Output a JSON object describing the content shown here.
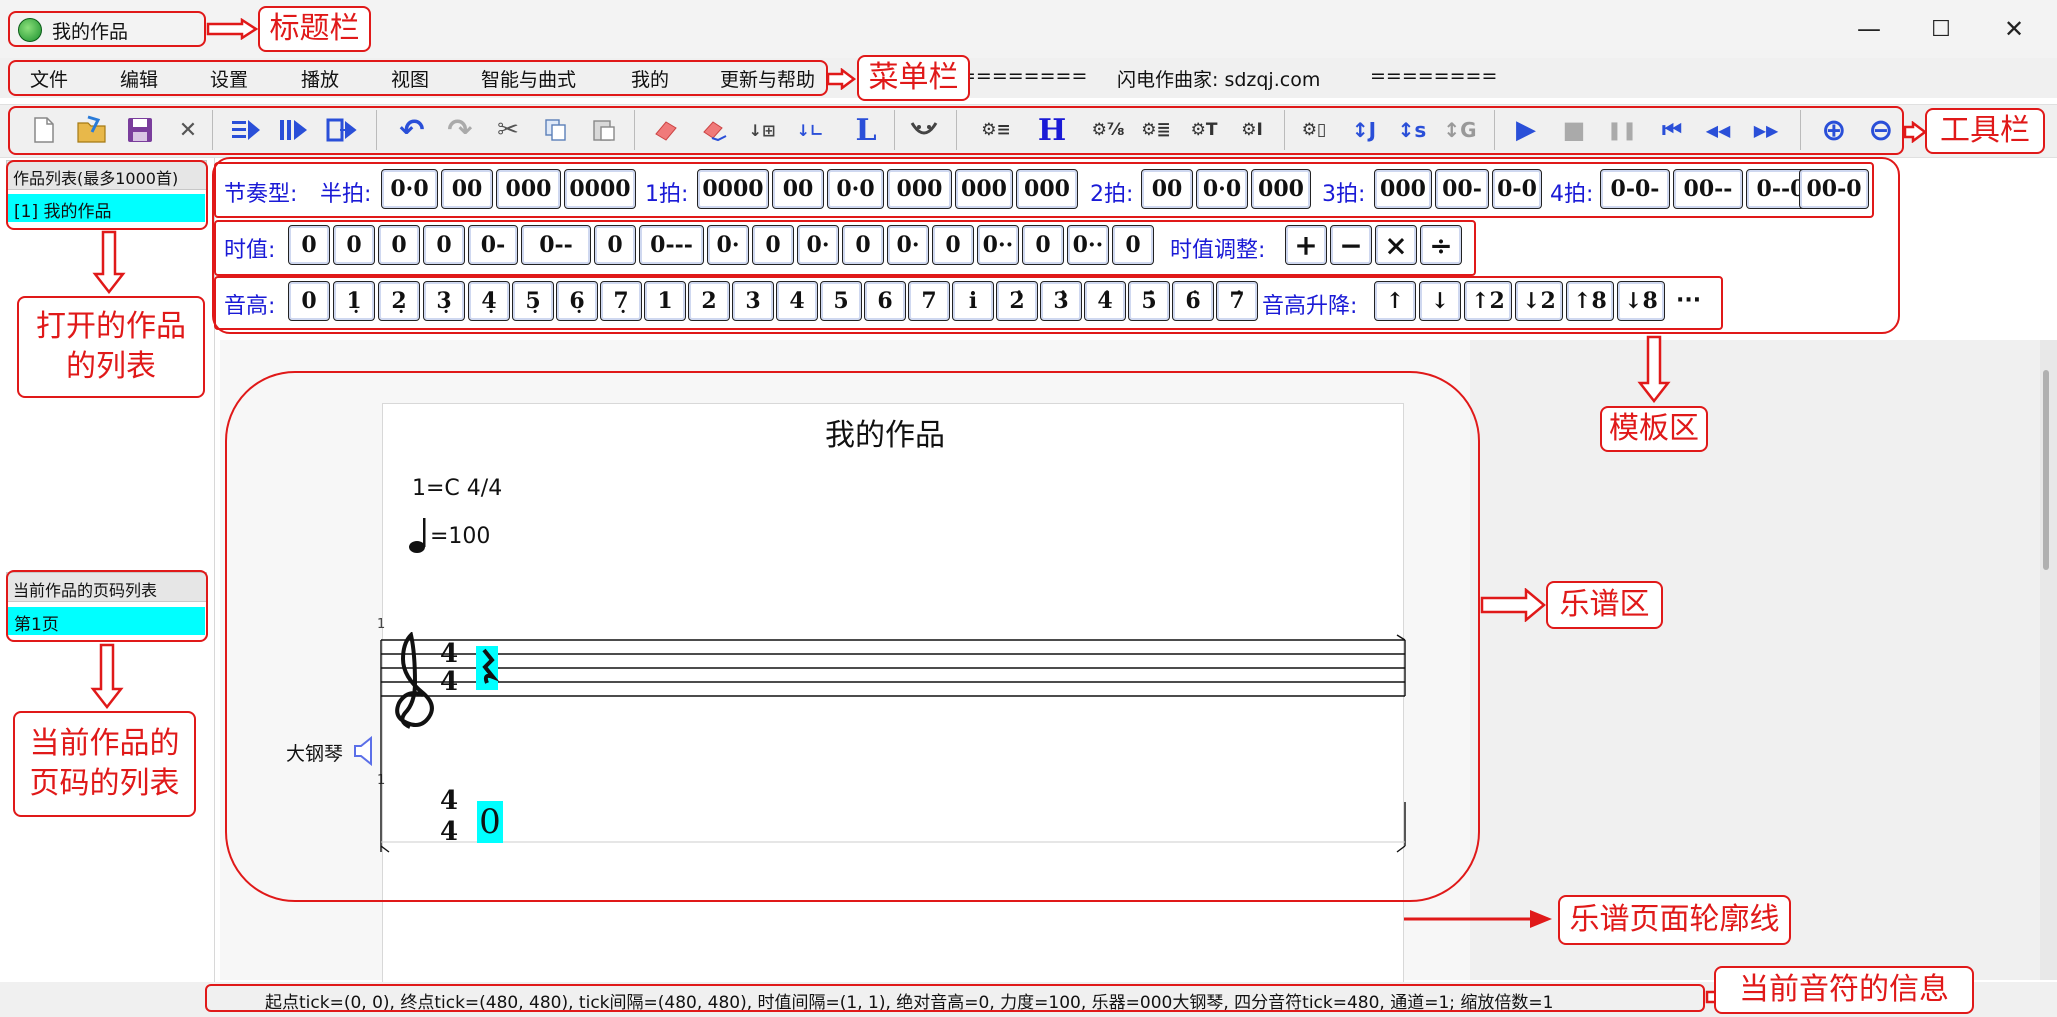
{
  "window": {
    "title": "我的作品",
    "minimize": "—",
    "maximize": "☐",
    "close": "✕"
  },
  "menu": {
    "items": [
      "文件",
      "编辑",
      "设置",
      "播放",
      "视图",
      "智能与曲式",
      "我的",
      "更新与帮助"
    ],
    "extra_left": "========",
    "site": "闪电作曲家: sdzqj.com",
    "extra_right": "========"
  },
  "toolbar": {
    "icons": [
      "new-file-icon",
      "open-folder-icon",
      "save-icon",
      "close-icon",
      "play-from-icon",
      "play-selection-icon",
      "export-icon",
      "undo-icon",
      "redo-icon",
      "cut-icon",
      "copy-icon",
      "paste-icon",
      "eraser-icon",
      "clear-icon",
      "insert-note-icon",
      "insert-rest-icon",
      "lyrics-L-icon",
      "tie-icon",
      "settings-list-icon",
      "heading-H-icon",
      "settings-fraction-icon",
      "settings-lines-icon",
      "settings-T-icon",
      "settings-I-icon",
      "settings-box-icon",
      "transpose-J-icon",
      "transpose-S-icon",
      "transpose-G-icon",
      "play-icon",
      "stop-icon",
      "pause-icon",
      "skip-start-icon",
      "rewind-icon",
      "fast-forward-icon",
      "zoom-in-icon",
      "zoom-out-icon"
    ],
    "glyphs": {
      "close": "✕",
      "undo": "↶",
      "redo": "↷",
      "cut": "✂",
      "L": "L",
      "H": "H",
      "settings_list": "⚙≡",
      "settings_frac": "⚙⅞",
      "settings_lines": "⚙≣",
      "settings_T": "⚙T",
      "settings_I": "⚙I",
      "settings_box": "⚙▯",
      "tJ": "↕J",
      "tS": "↕s",
      "tG": "↕G",
      "play": "▶",
      "stop": "■",
      "pause": "❚❚",
      "skip_start": "⏮",
      "rewind": "◀◀",
      "ff": "▶▶",
      "zoom_in": "⊕",
      "zoom_out": "⊖"
    }
  },
  "works_panel": {
    "header": "作品列表(最多1000首)",
    "items": [
      "[1] 我的作品"
    ]
  },
  "pages_panel": {
    "header": "当前作品的页码列表",
    "items": [
      "第1页"
    ]
  },
  "template": {
    "rhythm_label": "节奏型:",
    "half_label": "半拍:",
    "half_buttons": [
      "0·0",
      "00",
      "000",
      "0000"
    ],
    "one_label": "1拍:",
    "one_buttons": [
      "0000",
      "00",
      "0·0",
      "000",
      "000",
      "000"
    ],
    "two_label": "2拍:",
    "two_buttons": [
      "00",
      "0·0",
      "000"
    ],
    "three_label": "3拍:",
    "three_buttons": [
      "000",
      "00-",
      "0-0"
    ],
    "four_label": "4拍:",
    "four_buttons": [
      "0-0-",
      "00--",
      "0--0",
      "00-0"
    ],
    "duration_label": "时值:",
    "duration_buttons": [
      "0",
      "0",
      "0",
      "0",
      "0-",
      "0--",
      "0",
      "0---",
      "0·",
      "0",
      "0·",
      "0",
      "0·",
      "0",
      "0··",
      "0",
      "0··",
      "0"
    ],
    "duration_adjust_label": "时值调整:",
    "duration_adjust_buttons": [
      "+",
      "−",
      "×",
      "÷"
    ],
    "pitch_label": "音高:",
    "pitch_buttons": [
      "0",
      "1̣",
      "2̣",
      "3̣",
      "4̣",
      "5̣",
      "6̣",
      "7̣",
      "1",
      "2",
      "3",
      "4",
      "5",
      "6",
      "7",
      "i",
      "2̇",
      "3̇",
      "4̇",
      "5̇",
      "6̇",
      "7̇"
    ],
    "pitch_shift_label": "音高升降:",
    "pitch_shift_buttons": [
      "↑",
      "↓",
      "↑2",
      "↓2",
      "↑8",
      "↓8",
      "···"
    ]
  },
  "score": {
    "title": "我的作品",
    "key": "1=C  4/4",
    "tempo": "=100",
    "measure_no": "1",
    "measure_no2": "1",
    "time_sig_top": "4",
    "time_sig_bottom": "4",
    "jianpu_note": "0",
    "instrument": "大钢琴"
  },
  "status": {
    "text": "起点tick=(0, 0), 终点tick=(480, 480), tick间隔=(480, 480), 时值间隔=(1, 1), 绝对音高=0, 力度=100, 乐器=000大钢琴, 四分音符tick=480, 通道=1; 缩放倍数=1"
  },
  "annotations": {
    "titlebar": "标题栏",
    "menubar": "菜单栏",
    "toolbar": "工具栏",
    "works_list": "打开的作品\n的列表",
    "pages_list": "当前作品的\n页码的列表",
    "template_area": "模板区",
    "score_area": "乐谱区",
    "page_outline": "乐谱页面轮廓线",
    "note_info": "当前音符的信息"
  },
  "colors": {
    "annotation_red": "#e01919",
    "selection_cyan": "#00ffff",
    "template_blue": "#1a1ad6",
    "toolbar_blue": "#2a4fd8"
  }
}
